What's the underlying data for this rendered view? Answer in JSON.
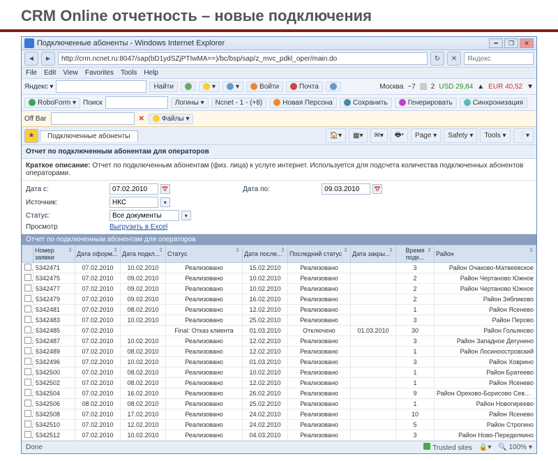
{
  "slide_title": "CRM Online отчетность – новые подключения",
  "window": {
    "title": "Подключенные абоненты - Windows Internet Explorer",
    "url": "http://crm.ncnet.ru:8047/sap(bD1ydSZjPTIwMA==)/bc/bsp/sap/z_mvc_pdkl_oper/main.do",
    "search_brand": "Яндекс"
  },
  "menu": [
    "File",
    "Edit",
    "View",
    "Favorites",
    "Tools",
    "Help"
  ],
  "yandex_bar": {
    "label": "Яндекс ▾",
    "search": "",
    "find": "Найти",
    "login": "Войти",
    "mail": "Почта",
    "moscow": "Москва",
    "temp": "−7",
    "usd": "USD 29,84",
    "eur": "EUR 40,52"
  },
  "roboform": {
    "label": "RoboForm ▾",
    "search_label": "Поиск",
    "logins": "Логины ▾",
    "ncnet": "Ncnet - 1 - (+8)",
    "persona": "Новая Персона",
    "save": "Сохранить",
    "generate": "Генерировать",
    "sync": "Синхронизация"
  },
  "offbar": {
    "label": "Off Bar",
    "files": "Файлы ▾"
  },
  "tab": {
    "label": "Подключенные абоненты"
  },
  "ie_tools": {
    "home": "▾",
    "feeds": "▾",
    "print": "▾",
    "page": "Page ▾",
    "safety": "Safety ▾",
    "tools": "Tools ▾"
  },
  "report": {
    "title": "Отчет по подключенным абонентам для операторов",
    "desc_label": "Краткое описание:",
    "desc": "Отчет по подключенным абонентам (физ. лица) к услуге интернет. Используется для подсчета количества подключенных абонентов операторами."
  },
  "filters": {
    "date_from_label": "Дата с:",
    "date_from": "07.02.2010",
    "date_to_label": "Дата по:",
    "date_to": "09.03.2010",
    "source_label": "Источник:",
    "source": "НКС",
    "status_label": "Статус:",
    "status": "Все документы",
    "view_label": "Просмотр",
    "export": "Выгрузить в Excel"
  },
  "sub_header": "Отчет по подключенным абонентам для операторов",
  "columns": [
    "",
    "Номер заявки",
    "Дата оформ...",
    "Дата подкл...",
    "Статус",
    "Дата после...",
    "Последний статус",
    "Дата закры...",
    "Время подк...",
    "Район"
  ],
  "rows": [
    {
      "id": "5342471",
      "d1": "07.02.2010",
      "d2": "10.02.2010",
      "status": "Реализовано",
      "d3": "15.02.2010",
      "ls": "Реализовано",
      "dc": "",
      "t": "3",
      "region": "Район Очаково-Матвеевское"
    },
    {
      "id": "5342475",
      "d1": "07.02.2010",
      "d2": "09.02.2010",
      "status": "Реализовано",
      "d3": "10.02.2010",
      "ls": "Реализовано",
      "dc": "",
      "t": "2",
      "region": "Район Чертаново Южное"
    },
    {
      "id": "5342477",
      "d1": "07.02.2010",
      "d2": "09.02.2010",
      "status": "Реализовано",
      "d3": "10.02.2010",
      "ls": "Реализовано",
      "dc": "",
      "t": "2",
      "region": "Район Чертаново Южное"
    },
    {
      "id": "5342479",
      "d1": "07.02.2010",
      "d2": "09.02.2010",
      "status": "Реализовано",
      "d3": "16.02.2010",
      "ls": "Реализовано",
      "dc": "",
      "t": "2",
      "region": "Район Зябликово"
    },
    {
      "id": "5342481",
      "d1": "07.02.2010",
      "d2": "08.02.2010",
      "status": "Реализовано",
      "d3": "12.02.2010",
      "ls": "Реализовано",
      "dc": "",
      "t": "1",
      "region": "Район Ясенево"
    },
    {
      "id": "5342483",
      "d1": "07.02.2010",
      "d2": "10.02.2010",
      "status": "Реализовано",
      "d3": "25.02.2010",
      "ls": "Реализовано",
      "dc": "",
      "t": "3",
      "region": "Район Перово"
    },
    {
      "id": "5342485",
      "d1": "07.02.2010",
      "d2": "",
      "status": "Final: Отказ клиента",
      "d3": "01.03.2010",
      "ls": "Отключено",
      "dc": "01.03.2010",
      "t": "30",
      "region": "Район Гольяново"
    },
    {
      "id": "5342487",
      "d1": "07.02.2010",
      "d2": "10.02.2010",
      "status": "Реализовано",
      "d3": "12.02.2010",
      "ls": "Реализовано",
      "dc": "",
      "t": "3",
      "region": "Район Западное Дегунино"
    },
    {
      "id": "5342489",
      "d1": "07.02.2010",
      "d2": "08.02.2010",
      "status": "Реализовано",
      "d3": "12.02.2010",
      "ls": "Реализовано",
      "dc": "",
      "t": "1",
      "region": "Район Лосиноостровский"
    },
    {
      "id": "5342496",
      "d1": "07.02.2010",
      "d2": "10.02.2010",
      "status": "Реализовано",
      "d3": "01.03.2010",
      "ls": "Реализовано",
      "dc": "",
      "t": "3",
      "region": "Район Ховрино"
    },
    {
      "id": "5342500",
      "d1": "07.02.2010",
      "d2": "08.02.2010",
      "status": "Реализовано",
      "d3": "10.02.2010",
      "ls": "Реализовано",
      "dc": "",
      "t": "1",
      "region": "Район Братеево"
    },
    {
      "id": "5342502",
      "d1": "07.02.2010",
      "d2": "08.02.2010",
      "status": "Реализовано",
      "d3": "12.02.2010",
      "ls": "Реализовано",
      "dc": "",
      "t": "1",
      "region": "Район Ясенево"
    },
    {
      "id": "5342504",
      "d1": "07.02.2010",
      "d2": "16.02.2010",
      "status": "Реализовано",
      "d3": "26.02.2010",
      "ls": "Реализовано",
      "dc": "",
      "t": "9",
      "region": "Район Орехово-Борисово Северное"
    },
    {
      "id": "5342506",
      "d1": "08.02.2010",
      "d2": "08.02.2010",
      "status": "Реализовано",
      "d3": "25.02.2010",
      "ls": "Реализовано",
      "dc": "",
      "t": "1",
      "region": "Район Новогиреево"
    },
    {
      "id": "5342508",
      "d1": "07.02.2010",
      "d2": "17.02.2010",
      "status": "Реализовано",
      "d3": "24.02.2010",
      "ls": "Реализовано",
      "dc": "",
      "t": "10",
      "region": "Район Ясенево"
    },
    {
      "id": "5342510",
      "d1": "07.02.2010",
      "d2": "12.02.2010",
      "status": "Реализовано",
      "d3": "24.02.2010",
      "ls": "Реализовано",
      "dc": "",
      "t": "5",
      "region": "Район Строгино"
    },
    {
      "id": "5342512",
      "d1": "07.02.2010",
      "d2": "10.02.2010",
      "status": "Реализовано",
      "d3": "04.03.2010",
      "ls": "Реализовано",
      "dc": "",
      "t": "3",
      "region": "Район Ново-Переделкино"
    }
  ],
  "statusbar": {
    "done": "Done",
    "trusted": "Trusted sites",
    "zoom": "100%"
  }
}
